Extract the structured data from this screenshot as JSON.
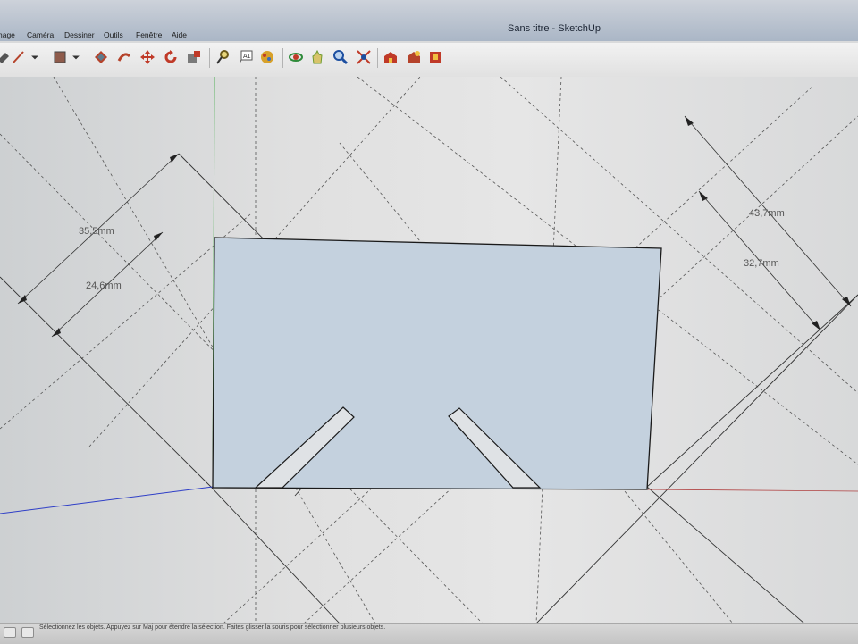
{
  "window": {
    "title": "Sans titre - SketchUp"
  },
  "menu": [
    "hage",
    "Caméra",
    "Dessiner",
    "Outils",
    "Fenêtre",
    "Aide"
  ],
  "toolbar": {
    "tools": [
      {
        "name": "paint-bucket-icon",
        "color": "#444444"
      },
      {
        "name": "shape-dropdown-icon",
        "color": "#444444"
      },
      {
        "name": "eraser-dropdown-icon",
        "color": "#a44a2f"
      },
      {
        "name": "pushpull-icon",
        "color": "#b5432b"
      },
      {
        "name": "followme-icon",
        "color": "#b5432b"
      },
      {
        "name": "move-icon",
        "color": "#b5432b"
      },
      {
        "name": "rotate-icon",
        "color": "#b5432b"
      },
      {
        "name": "scale-icon",
        "color": "#b5432b"
      },
      {
        "name": "tape-measure-icon",
        "color": "#6b5a1a"
      },
      {
        "name": "text-icon",
        "color": "#555555"
      },
      {
        "name": "paint-icon",
        "color": "#a67a1e"
      },
      {
        "name": "orbit-icon",
        "color": "#2f8b3a"
      },
      {
        "name": "pan-icon",
        "color": "#6e9b2f"
      },
      {
        "name": "zoom-icon",
        "color": "#1d4fa0"
      },
      {
        "name": "zoom-extents-icon",
        "color": "#b5432b"
      },
      {
        "name": "warehouse-icon",
        "color": "#b5432b"
      },
      {
        "name": "share-model-icon",
        "color": "#b5432b"
      },
      {
        "name": "extension-icon",
        "color": "#b5432b"
      }
    ]
  },
  "dimensions": [
    {
      "label": "35,5mm"
    },
    {
      "label": "24,6mm"
    },
    {
      "label": "43,7mm"
    },
    {
      "label": "32,7mm"
    }
  ],
  "status": {
    "message": "Sélectionnez les objets. Appuyez sur Maj pour étendre la sélection. Faites glisser la souris pour sélectionner plusieurs objets."
  },
  "colors": {
    "face": "#c4d1de",
    "edge": "#1a1a1a",
    "axis_green": "#4caf50",
    "axis_blue": "#2f3fc7"
  }
}
